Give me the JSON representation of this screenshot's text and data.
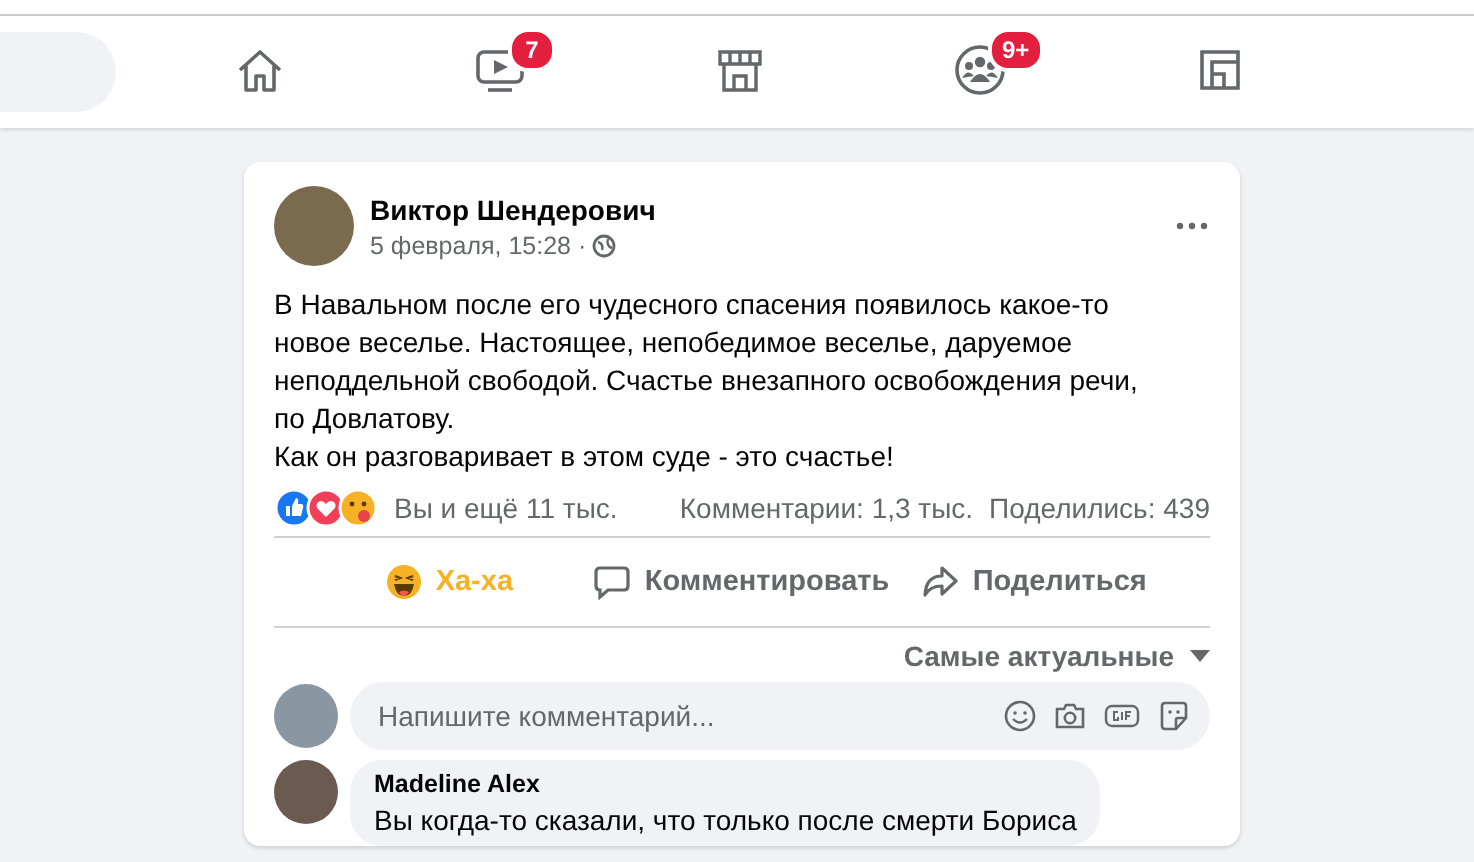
{
  "nav": {
    "items": [
      {
        "kind": "home",
        "selected": false
      },
      {
        "kind": "video",
        "badge": "7",
        "selected": false
      },
      {
        "kind": "marketplace",
        "selected": false
      },
      {
        "kind": "groups",
        "badge": "9+",
        "selected": false
      },
      {
        "kind": "gaming",
        "selected": false
      }
    ]
  },
  "post": {
    "author": "Виктор Шендерович",
    "date": "5 февраля, 15:28 ·",
    "paragraphs": [
      "В Навальном после его чудесного спасения появилось какое-то новое веселье. Настоящее, непобедимое веселье, даруемое неподдельной свободой. Счастье внезапного освобождения речи, по Довлатову.",
      "Как он разговаривает в этом суде - это счастье!"
    ],
    "reactions_text": "Вы и ещё 11 тыс.",
    "comments_count": "Комментарии: 1,3 тыс.",
    "shares_count": "Поделились: 439",
    "actions": [
      {
        "kind": "haha",
        "label": "Ха-ха",
        "selected": true
      },
      {
        "kind": "comment",
        "label": "Комментировать",
        "selected": false
      },
      {
        "kind": "share",
        "label": "Поделиться",
        "selected": false
      }
    ],
    "sort": "Самые актуальные",
    "comment_field": {
      "placeholder": "Напишите комментарий..."
    },
    "comments": [
      {
        "author": "Madeline Alex",
        "text": "Вы когда-то сказали, что только после смерти Бориса"
      }
    ]
  }
}
